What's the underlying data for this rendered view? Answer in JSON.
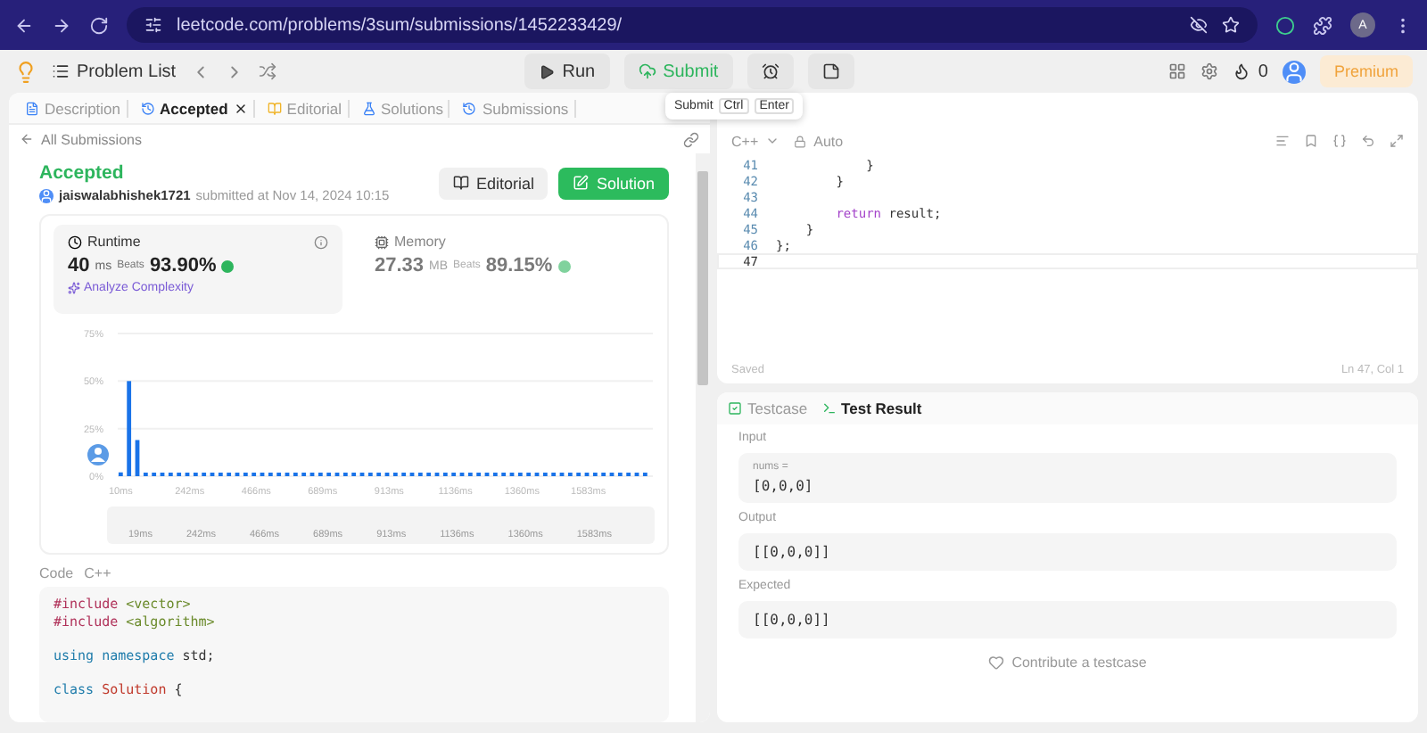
{
  "browser": {
    "url": "leetcode.com/problems/3sum/submissions/1452233429/",
    "profile": "A"
  },
  "header": {
    "problem_list": "Problem List",
    "run": "Run",
    "submit": "Submit",
    "streak": "0",
    "premium": "Premium"
  },
  "tooltip": {
    "label": "Submit",
    "keys": [
      "Ctrl",
      "Enter"
    ]
  },
  "left_tabs": [
    {
      "label": "Description",
      "kind": "description",
      "selected": false,
      "closable": false
    },
    {
      "label": "Accepted",
      "kind": "accepted",
      "selected": true,
      "closable": true
    },
    {
      "label": "Editorial",
      "kind": "editorial",
      "selected": false,
      "closable": false
    },
    {
      "label": "Solutions",
      "kind": "solutions",
      "selected": false,
      "closable": false
    },
    {
      "label": "Submissions",
      "kind": "submissions",
      "selected": false,
      "closable": false
    }
  ],
  "back_link": "All Submissions",
  "submission": {
    "status": "Accepted",
    "user": "jaiswalabhishek1721",
    "submitted": "submitted at Nov 14, 2024 10:15",
    "editorial_button": "Editorial",
    "solution_button": "Solution"
  },
  "stats": [
    {
      "kind": "runtime",
      "label": "Runtime",
      "value": "40",
      "unit": "ms",
      "beats_label": "Beats",
      "beats": "93.90%",
      "selected": true,
      "link": "Analyze Complexity"
    },
    {
      "kind": "memory",
      "label": "Memory",
      "value": "27.33",
      "unit": "MB",
      "beats_label": "Beats",
      "beats": "89.15%",
      "selected": false
    }
  ],
  "chart_data": {
    "type": "bar",
    "x": [
      10,
      38,
      66,
      94,
      122,
      150,
      178,
      206,
      234,
      262,
      290,
      318,
      346,
      374,
      402,
      430,
      458,
      486,
      514,
      542,
      570,
      598,
      626,
      654,
      682,
      710,
      738,
      766,
      794,
      822,
      850,
      878,
      906,
      934,
      962,
      990,
      1018,
      1046,
      1074,
      1102,
      1130,
      1158,
      1186,
      1214,
      1242,
      1270,
      1298,
      1326,
      1354,
      1382,
      1410,
      1438,
      1466,
      1494,
      1522,
      1550,
      1578,
      1606,
      1634,
      1662,
      1690,
      1718,
      1746,
      1774
    ],
    "values": [
      2,
      50,
      19,
      1,
      1,
      1,
      1,
      1,
      1,
      1,
      1,
      1,
      1,
      1,
      1,
      1,
      1,
      1,
      1,
      1,
      1,
      1,
      1,
      1,
      1,
      1,
      1,
      1,
      1,
      1,
      1,
      1,
      1,
      1,
      1,
      1,
      1,
      1,
      1,
      1,
      1,
      1,
      1,
      1,
      1,
      1,
      1,
      1,
      1,
      1,
      1,
      1,
      1,
      1,
      1,
      1,
      1,
      1,
      1,
      1,
      1,
      1,
      1,
      1
    ],
    "xticks": [
      {
        "value": 10,
        "label": "10ms"
      },
      {
        "value": 242,
        "label": "242ms"
      },
      {
        "value": 466,
        "label": "466ms"
      },
      {
        "value": 689,
        "label": "689ms"
      },
      {
        "value": 913,
        "label": "913ms"
      },
      {
        "value": 1136,
        "label": "1136ms"
      },
      {
        "value": 1360,
        "label": "1360ms"
      },
      {
        "value": 1583,
        "label": "1583ms"
      }
    ],
    "xlim": [
      0,
      1800
    ],
    "ylim": [
      0,
      75
    ],
    "yticks": [
      {
        "value": 0,
        "label": "0%"
      },
      {
        "value": 25,
        "label": "25%"
      },
      {
        "value": 50,
        "label": "50%"
      },
      {
        "value": 75,
        "label": "75%"
      }
    ]
  },
  "range_labels": [
    "19ms",
    "242ms",
    "466ms",
    "689ms",
    "913ms",
    "1136ms",
    "1360ms",
    "1583ms"
  ],
  "code_section": {
    "label": "Code",
    "language": "C++"
  },
  "code_tokens": [
    {
      "text": "#include",
      "kind": "directive"
    },
    {
      "text": " <vector>\n",
      "kind": "string"
    },
    {
      "text": "#include",
      "kind": "directive"
    },
    {
      "text": " <algorithm>\n\n",
      "kind": "string"
    },
    {
      "text": "using",
      "kind": "keyword"
    },
    {
      "text": " namespace",
      "kind": "keyword"
    },
    {
      "text": " std;\n\n",
      "kind": "plain"
    },
    {
      "text": "class",
      "kind": "keyword"
    },
    {
      "text": " Solution",
      "kind": "type"
    },
    {
      "text": " {",
      "kind": "plain"
    }
  ],
  "editor": {
    "language": "C++",
    "mode": "Auto",
    "saved": "Saved",
    "position": "Ln 47, Col 1",
    "lines": [
      {
        "number": "41",
        "current": false,
        "segments": [
          {
            "text": "            }",
            "kind": "plain"
          }
        ]
      },
      {
        "number": "42",
        "current": false,
        "segments": [
          {
            "text": "        }",
            "kind": "plain"
          }
        ]
      },
      {
        "number": "43",
        "current": false
      },
      {
        "number": "44",
        "current": false,
        "segments": [
          {
            "text": "        return",
            "kind": "control"
          },
          {
            "text": " result;",
            "kind": "plain"
          }
        ]
      },
      {
        "number": "45",
        "current": false,
        "segments": [
          {
            "text": "    }",
            "kind": "plain"
          }
        ]
      },
      {
        "number": "46",
        "current": false,
        "segments": [
          {
            "text": "};",
            "kind": "plain"
          }
        ]
      },
      {
        "number": "47",
        "current": true
      }
    ]
  },
  "bottom_tabs": [
    {
      "label": "Testcase",
      "kind": "testcase",
      "selected": false
    },
    {
      "label": "Test Result",
      "kind": "result",
      "selected": true
    }
  ],
  "result": {
    "input_label": "Input",
    "param": "nums =",
    "input": "[0,0,0]",
    "output_label": "Output",
    "output": "[[0,0,0]]",
    "expected_label": "Expected",
    "expected": "[[0,0,0]]",
    "contribute": "Contribute a testcase"
  }
}
